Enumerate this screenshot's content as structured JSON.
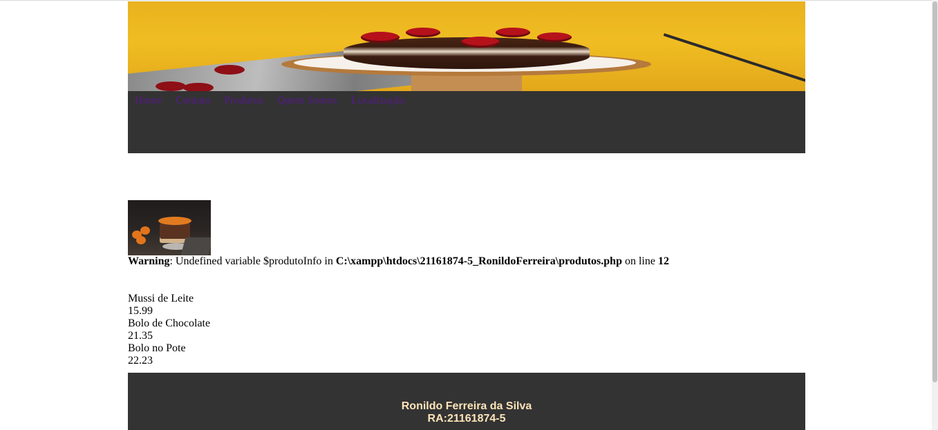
{
  "nav": {
    "items": [
      {
        "label": "Home"
      },
      {
        "label": "Contato"
      },
      {
        "label": "Produtos"
      },
      {
        "label": "Quem Somos"
      },
      {
        "label": "Localização"
      }
    ]
  },
  "warning": {
    "label": "Warning",
    "text_before_path": ": Undefined variable $produtoInfo in ",
    "path": "C:\\xampp\\htdocs\\21161874-5_RonildoFerreira\\produtos.php",
    "text_before_line": " on line ",
    "line": "12"
  },
  "products": [
    {
      "name": "Mussi de Leite",
      "price": "15.99"
    },
    {
      "name": "Bolo de Chocolate",
      "price": "21.35"
    },
    {
      "name": "Bolo no Pote",
      "price": "22.23"
    }
  ],
  "footer": {
    "name": "Ronildo Ferreira da Silva",
    "ra": "RA:21161874-5"
  },
  "colors": {
    "nav_background": "#333333",
    "link_visited": "#551a8b",
    "footer_text": "#fde4b8"
  }
}
